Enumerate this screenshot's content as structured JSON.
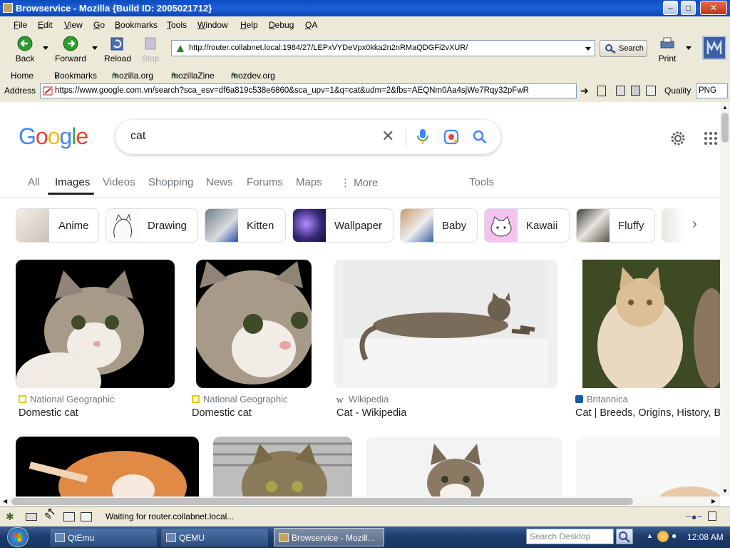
{
  "window": {
    "title": "Browservice - Mozilla {Build ID: 2005021712}"
  },
  "menu": [
    "File",
    "Edit",
    "View",
    "Go",
    "Bookmarks",
    "Tools",
    "Window",
    "Help",
    "Debug",
    "QA"
  ],
  "nav": {
    "back": "Back",
    "forward": "Forward",
    "reload": "Reload",
    "stop": "Stop",
    "print": "Print",
    "search": "Search"
  },
  "url_bar": {
    "value": "http://router.collabnet.local:1984/27/LEPxVYDeVpx0kka2n2nRMaQDGFi2vXUR/"
  },
  "bookmarks": [
    "Home",
    "Bookmarks",
    "mozilla.org",
    "mozillaZine",
    "mozdev.org"
  ],
  "address": {
    "label": "Address",
    "value": "https://www.google.com.vn/search?sca_esv=df6a819c538e6860&sca_upv=1&q=cat&udm=2&fbs=AEQNm0Aa4sjWe7Rqy32pFwR",
    "quality_label": "Quality",
    "quality_value": "PNG"
  },
  "google": {
    "logo": "Google",
    "query": "cat",
    "tabs": [
      "All",
      "Images",
      "Videos",
      "Shopping",
      "News",
      "Forums",
      "Maps",
      "⋮ More"
    ],
    "active_tab": "Images",
    "tools": "Tools",
    "chips": [
      "Anime",
      "Drawing",
      "Kitten",
      "Wallpaper",
      "Baby",
      "Kawaii",
      "Fluffy"
    ],
    "results": [
      {
        "source": "National Geographic",
        "title": "Domestic cat"
      },
      {
        "source": "National Geographic",
        "title": "Domestic cat"
      },
      {
        "source": "Wikipedia",
        "title": "Cat - Wikipedia"
      },
      {
        "source": "Britannica",
        "title": "Cat | Breeds, Origins, History, B"
      }
    ],
    "colors": {
      "blue": "#4285f4",
      "red": "#ea4335",
      "yellow": "#fbbc05",
      "green": "#34a853"
    }
  },
  "status": {
    "text": "Waiting for router.collabnet.local..."
  },
  "taskbar": {
    "items": [
      "QtEmu",
      "QEMU",
      "Browservice - Mozill..."
    ],
    "search_placeholder": "Search Desktop",
    "time": "12:08 AM"
  }
}
